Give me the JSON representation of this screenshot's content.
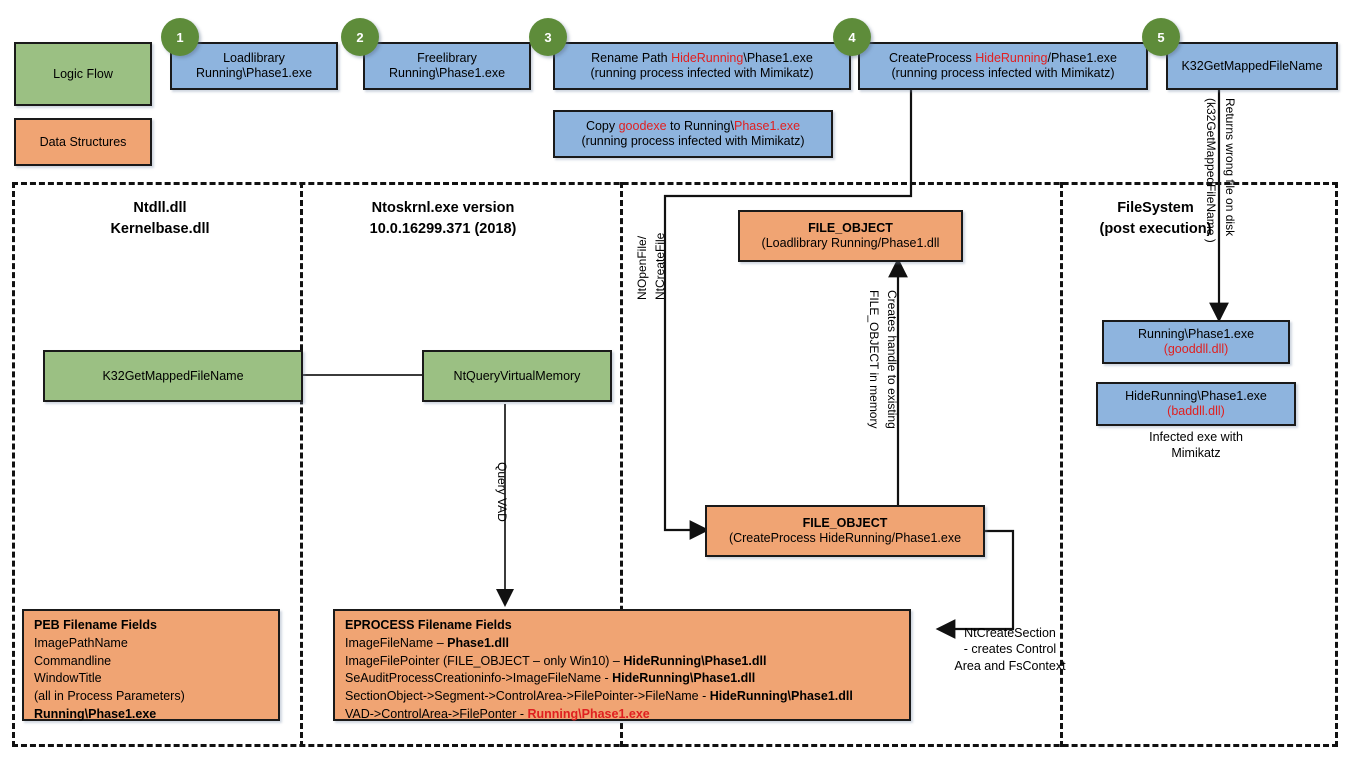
{
  "legend": {
    "logic_flow": "Logic Flow",
    "data_structures": "Data Structures",
    "colors": {
      "logic_flow": "#9BC083",
      "data_structures": "#F0A473",
      "step_badge": "#5E8C3A",
      "api_call": "#8EB4DE",
      "highlight": "#E02020"
    }
  },
  "steps": [
    {
      "number": "1",
      "line1": "Loadlibrary",
      "line2": "Running\\Phase1.exe"
    },
    {
      "number": "2",
      "line1": "Freelibrary",
      "line2": "Running\\Phase1.exe"
    },
    {
      "number": "3",
      "line1_pre": "Rename Path ",
      "line1_red": "HideRunning",
      "line1_post": "\\Phase1.exe",
      "line2": "(running process infected with Mimikatz)"
    },
    {
      "number": "4",
      "line1_pre": "CreateProcess ",
      "line1_red": "HideRunning",
      "line1_post": "/Phase1.exe",
      "line2": "(running process infected with Mimikatz)"
    },
    {
      "number": "5",
      "line1": "K32GetMappedFileName"
    }
  ],
  "copy_box": {
    "pre": "Copy ",
    "red1": "goodexe",
    "mid": " to Running\\",
    "red2": "Phase1.exe",
    "line2": "(running process infected with Mimikatz)"
  },
  "sections": [
    {
      "title_line1": "Ntdll.dll",
      "title_line2": "Kernelbase.dll"
    },
    {
      "title_line1": "Ntoskrnl.exe version",
      "title_line2": "10.0.16299.371 (2018)"
    },
    {
      "title_line1": "FileSystem",
      "title_line2": "(post execution)"
    }
  ],
  "nodes": {
    "k32": "K32GetMappedFileName",
    "ntqvm": "NtQueryVirtualMemory",
    "file_object_load_l1": "FILE_OBJECT",
    "file_object_load_l2": "(Loadlibrary Running/Phase1.dll",
    "file_object_create_l1": "FILE_OBJECT",
    "file_object_create_l2": "(CreateProcess HideRunning/Phase1.exe"
  },
  "filesystem": {
    "good_file_line1": "Running\\Phase1.exe",
    "good_file_line2": "(gooddll.dll)",
    "bad_file_line1": "HideRunning\\Phase1.exe",
    "bad_file_line2": "(baddll.dll)",
    "bad_file_caption_l1": "Infected exe with",
    "bad_file_caption_l2": "Mimikatz"
  },
  "edge_labels": {
    "returns_wrong_file": "Returns wrong file on disk",
    "returns_wrong_file_api": "(k32GetMappedFileName )",
    "nt_open_create_l1": "NtOpenFile/",
    "nt_open_create_l2": "NtCreateFile",
    "creates_handle_l1": "Creates handle to existing",
    "creates_handle_l2": "FILE_OBJECT in memory",
    "query_vad": "Query VAD",
    "nt_create_section_l1": "NtCreateSection",
    "nt_create_section_l2": "- creates Control",
    "nt_create_section_l3": "Area and FsContext"
  },
  "peb_box": {
    "header": "PEB Filename Fields",
    "rows": [
      "ImagePathName",
      "Commandline",
      "WindowTitle",
      "(all in Process Parameters)"
    ],
    "footer": "Running\\Phase1.exe"
  },
  "eprocess_box": {
    "header": "EPROCESS Filename Fields",
    "rows": [
      {
        "label": "ImageFileName – ",
        "value": "Phase1.dll",
        "bold_value": true,
        "red_value": false
      },
      {
        "label": "ImageFilePointer (FILE_OBJECT – only Win10) – ",
        "value": "HideRunning\\Phase1.dll",
        "bold_value": true,
        "red_value": false
      },
      {
        "label": "SeAuditProcessCreationinfo->ImageFileName - ",
        "value": "HideRunning\\Phase1.dll",
        "bold_value": true,
        "red_value": false
      },
      {
        "label": "SectionObject->Segment->ControlArea->FilePointer->FileName - ",
        "value": "HideRunning\\Phase1.dll",
        "bold_value": true,
        "red_value": false
      },
      {
        "label": "VAD->ControlArea->FilePonter - ",
        "value": "Running\\Phase1.exe",
        "bold_value": true,
        "red_value": true
      }
    ]
  }
}
